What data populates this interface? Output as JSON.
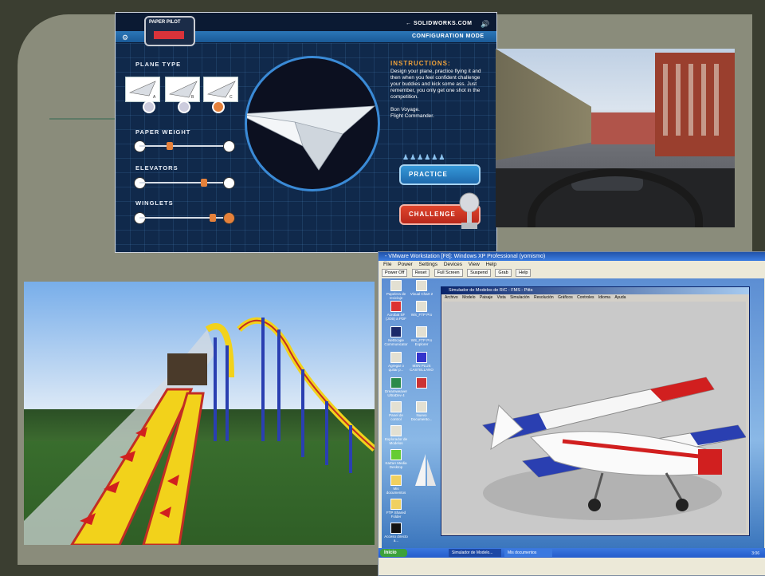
{
  "paper_pilot": {
    "logo_line1": "PAPER",
    "logo_line2": "PILOT",
    "logo_sub": "",
    "site_link": "← SOLIDWORKS.COM",
    "mode": "CONFIGURATION MODE",
    "sections": {
      "plane_type": "PLANE TYPE",
      "paper_weight": "PAPER WEIGHT",
      "elevators": "ELEVATORS",
      "winglets": "WINGLETS"
    },
    "plane_labels": [
      "A",
      "B",
      "C"
    ],
    "selected_plane": 3,
    "sliders": {
      "paper_weight": 0.33,
      "elevators": 0.74,
      "winglets": 0.85
    },
    "instructions": {
      "heading": "INSTRUCTIONS:",
      "body": "Design your plane, practice flying it and then when you feel confident challenge your buddies and kick some ass. Just remember, you only get one shot in the competition.",
      "signoff1": "Bon Voyage.",
      "signoff2": "Flight Commander."
    },
    "practice_label": "PRACTICE",
    "challenge_label": "CHALLENGE",
    "colors": {
      "bg": "#10294b",
      "accent_blue": "#3597d8",
      "accent_red": "#e0452c",
      "knob": "#e5813b"
    }
  },
  "vmware": {
    "title": "- VMware Workstation [F8]: Windows XP Professional (yomismo)",
    "menu": [
      "File",
      "Power",
      "Settings",
      "Devices",
      "View",
      "Help"
    ],
    "toolbar": [
      "Power Off",
      "Reset",
      "Full Screen",
      "Suspend",
      "Grab",
      "Help"
    ],
    "desktop_icons": [
      "Papelera de reciclaje",
      "Visual Chart 2",
      "Acrobat SF (JOB) a PDF",
      "WS_FTP Pro",
      "NetScape Communicator",
      "WS_FTP Pro Explorer",
      "Agregar o quitar p...",
      "MSN PLUS CASTELLANO",
      "Dreamweaver UltraDev 4",
      "",
      "Panel de control",
      "Nuevo Documento...",
      "Explorador de Modelos",
      "KaZaA Media Desktop",
      "Mis documentos",
      "FTP Shared Folder",
      "Acceso directo a..."
    ],
    "sim_window": {
      "title": "Simulador de Modelos de R/C - FMS - Pitts",
      "menu": [
        "Archivo",
        "Modelo",
        "Paisaje",
        "Vista",
        "Simulación",
        "Resolución",
        "Gráficos",
        "Controles",
        "Idioma",
        "Ayuda"
      ]
    },
    "taskbar": {
      "start": "Inicio",
      "items": [
        "Simulador de Modelo...",
        "Mis documentos"
      ],
      "clock": "3:06"
    }
  }
}
